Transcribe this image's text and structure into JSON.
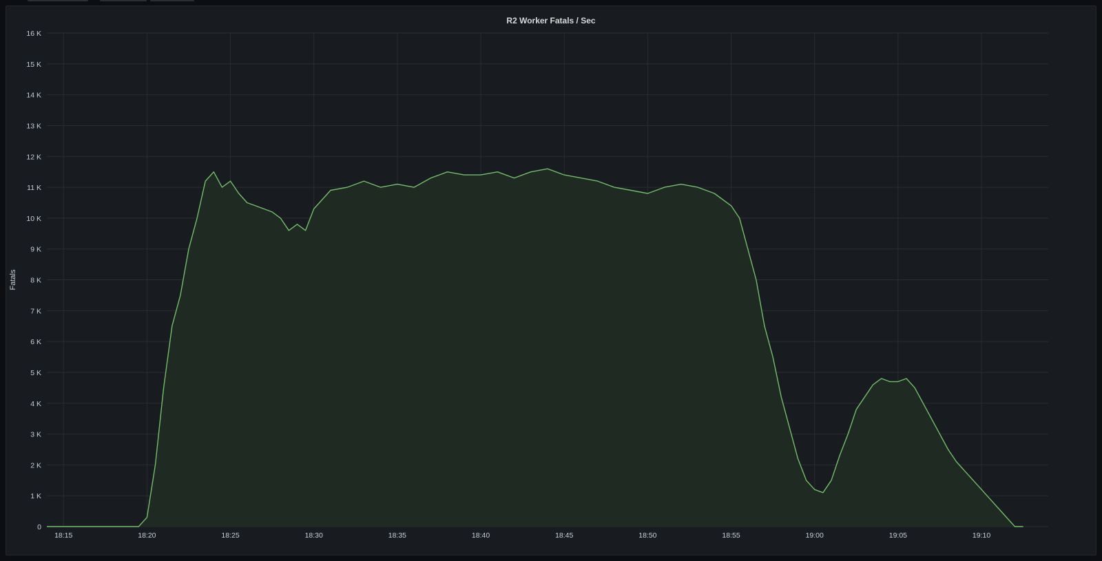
{
  "panel": {
    "title": "R2 Worker Fatals / Sec"
  },
  "colors": {
    "background": "#0d0e11",
    "panel": "#181b1f",
    "grid": "#2a2d32",
    "line": "#73bf69",
    "fill": "#1f2a22",
    "text": "#c7d0d9"
  },
  "chart_data": {
    "type": "area",
    "title": "R2 Worker Fatals / Sec",
    "xlabel": "",
    "ylabel": "Fatals",
    "grid": true,
    "legend": "none",
    "xlim": [
      "18:14",
      "19:14"
    ],
    "ylim": [
      0,
      16000
    ],
    "y_ticks": [
      0,
      1000,
      2000,
      3000,
      4000,
      5000,
      6000,
      7000,
      8000,
      9000,
      10000,
      11000,
      12000,
      13000,
      14000,
      15000,
      16000
    ],
    "y_tick_labels": [
      "0",
      "1 K",
      "2 K",
      "3 K",
      "4 K",
      "5 K",
      "6 K",
      "7 K",
      "8 K",
      "9 K",
      "10 K",
      "11 K",
      "12 K",
      "13 K",
      "14 K",
      "15 K",
      "16 K"
    ],
    "x_ticks": [
      "18:15",
      "18:20",
      "18:25",
      "18:30",
      "18:35",
      "18:40",
      "18:45",
      "18:50",
      "18:55",
      "19:00",
      "19:05",
      "19:10"
    ],
    "series": [
      {
        "x": [
          "18:14:00",
          "18:15:00",
          "18:16:00",
          "18:17:00",
          "18:18:00",
          "18:19:00",
          "18:19:30",
          "18:20:00",
          "18:20:30",
          "18:21:00",
          "18:21:30",
          "18:22:00",
          "18:22:30",
          "18:23:00",
          "18:23:30",
          "18:24:00",
          "18:24:30",
          "18:25:00",
          "18:25:30",
          "18:26:00",
          "18:26:30",
          "18:27:00",
          "18:27:30",
          "18:28:00",
          "18:28:30",
          "18:29:00",
          "18:29:30",
          "18:30:00",
          "18:31:00",
          "18:32:00",
          "18:33:00",
          "18:34:00",
          "18:35:00",
          "18:36:00",
          "18:37:00",
          "18:38:00",
          "18:39:00",
          "18:40:00",
          "18:41:00",
          "18:42:00",
          "18:43:00",
          "18:44:00",
          "18:45:00",
          "18:46:00",
          "18:47:00",
          "18:48:00",
          "18:49:00",
          "18:50:00",
          "18:51:00",
          "18:52:00",
          "18:53:00",
          "18:54:00",
          "18:55:00",
          "18:55:30",
          "18:56:00",
          "18:56:30",
          "18:57:00",
          "18:57:30",
          "18:58:00",
          "18:58:30",
          "18:59:00",
          "18:59:30",
          "19:00:00",
          "19:00:30",
          "19:01:00",
          "19:01:30",
          "19:02:00",
          "19:02:30",
          "19:03:00",
          "19:03:30",
          "19:04:00",
          "19:04:30",
          "19:05:00",
          "19:05:30",
          "19:06:00",
          "19:06:30",
          "19:07:00",
          "19:07:30",
          "19:08:00",
          "19:08:30",
          "19:09:00",
          "19:09:30",
          "19:10:00",
          "19:10:30",
          "19:11:00",
          "19:11:30",
          "19:12:00",
          "19:12:30"
        ],
        "values": [
          0,
          0,
          0,
          0,
          0,
          0,
          0,
          300,
          2000,
          4500,
          6500,
          7500,
          9000,
          10000,
          11200,
          11500,
          11000,
          11200,
          10800,
          10500,
          10400,
          10300,
          10200,
          10000,
          9600,
          9800,
          9600,
          10300,
          10900,
          11000,
          11200,
          11000,
          11100,
          11000,
          11300,
          11500,
          11400,
          11400,
          11500,
          11300,
          11500,
          11600,
          11400,
          11300,
          11200,
          11000,
          10900,
          10800,
          11000,
          11100,
          11000,
          10800,
          10400,
          10000,
          9000,
          8000,
          6500,
          5500,
          4200,
          3200,
          2200,
          1500,
          1200,
          1100,
          1500,
          2300,
          3000,
          3800,
          4200,
          4600,
          4800,
          4700,
          4700,
          4800,
          4500,
          4000,
          3500,
          3000,
          2500,
          2100,
          1800,
          1500,
          1200,
          900,
          600,
          300,
          0,
          0
        ]
      }
    ]
  }
}
